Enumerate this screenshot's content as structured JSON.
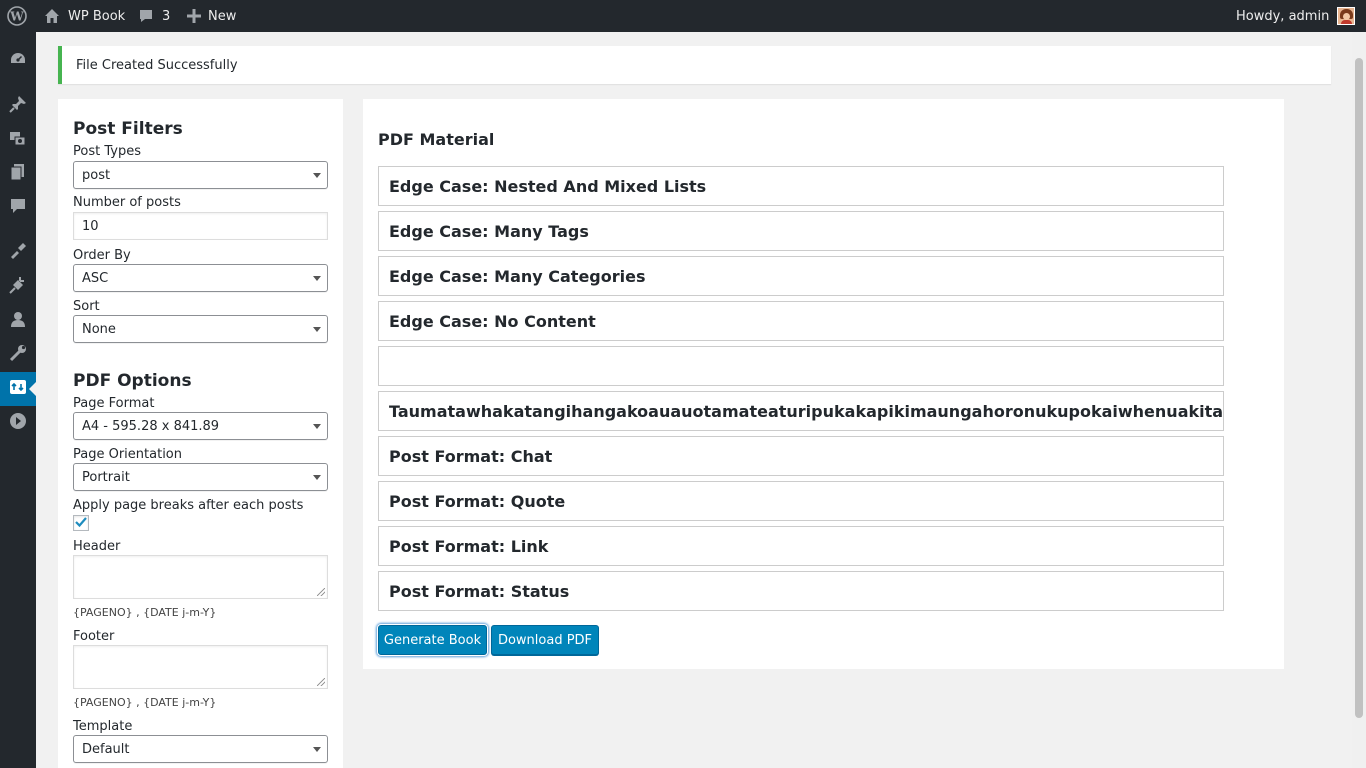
{
  "adminbar": {
    "site_name": "WP Book",
    "comments_count": "3",
    "new_label": "New",
    "greeting": "Howdy, admin"
  },
  "sidebar": {
    "items": [
      {
        "icon": "dashboard-icon"
      },
      {
        "icon": "pin-icon"
      },
      {
        "icon": "media-icon"
      },
      {
        "icon": "pages-icon"
      },
      {
        "icon": "comments-icon"
      },
      {
        "icon": "appearance-icon"
      },
      {
        "icon": "plugins-icon"
      },
      {
        "icon": "users-icon"
      },
      {
        "icon": "tools-icon"
      },
      {
        "icon": "settings-icon",
        "active": true
      },
      {
        "icon": "collapse-icon"
      }
    ]
  },
  "notice": {
    "text": "File Created Successfully",
    "color": "#46b450"
  },
  "filters": {
    "post_filters_heading": "Post Filters",
    "post_types_label": "Post Types",
    "post_types_value": "post",
    "num_posts_label": "Number of posts",
    "num_posts_value": "10",
    "order_by_label": "Order By",
    "order_by_value": "ASC",
    "sort_label": "Sort",
    "sort_value": "None",
    "pdf_options_heading": "PDF Options",
    "page_format_label": "Page Format",
    "page_format_value": "A4 - 595.28 x 841.89",
    "page_orientation_label": "Page Orientation",
    "page_orientation_value": "Portrait",
    "page_breaks_label": "Apply page breaks after each posts",
    "page_breaks_checked": true,
    "header_label": "Header",
    "header_hint": "{PAGENO} , {DATE j-m-Y}",
    "footer_label": "Footer",
    "footer_hint": "{PAGENO} , {DATE j-m-Y}",
    "template_label": "Template",
    "template_value": "Default"
  },
  "pdf_material": {
    "title": "PDF Material",
    "items": [
      "Edge Case: Nested And Mixed Lists",
      "Edge Case: Many Tags",
      "Edge Case: Many Categories",
      "Edge Case: No Content",
      "",
      "Taumatawhakatangihangakoauauotamateaturipukakapikimaungahoronukupokaiwhenuakitanatahu",
      "Post Format: Chat",
      "Post Format: Quote",
      "Post Format: Link",
      "Post Format: Status"
    ],
    "generate_button": "Generate Book",
    "download_button": "Download PDF",
    "button_color": "#0085ba"
  }
}
